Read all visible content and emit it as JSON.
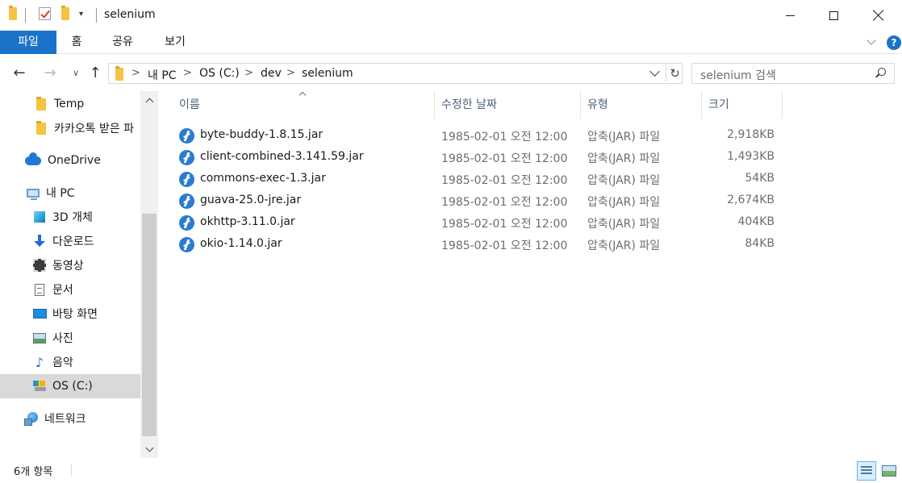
{
  "window": {
    "title": "selenium"
  },
  "ribbon": {
    "tabs": [
      {
        "label": "파일"
      },
      {
        "label": "홈"
      },
      {
        "label": "공유"
      },
      {
        "label": "보기"
      }
    ],
    "help_label": "?"
  },
  "navigation": {
    "breadcrumb": [
      "내 PC",
      "OS (C:)",
      "dev",
      "selenium"
    ],
    "separator": ">",
    "search_placeholder": "selenium 검색"
  },
  "sidebar": {
    "items": [
      {
        "label": "Temp",
        "icon": "folder-icon"
      },
      {
        "label": "카카오톡 받은 파",
        "icon": "folder-icon"
      },
      {
        "label": "OneDrive",
        "icon": "onedrive-icon"
      },
      {
        "label": "내 PC",
        "icon": "pc-icon"
      },
      {
        "label": "3D 개체",
        "icon": "3d-objects-icon"
      },
      {
        "label": "다운로드",
        "icon": "downloads-icon"
      },
      {
        "label": "동영상",
        "icon": "videos-icon"
      },
      {
        "label": "문서",
        "icon": "documents-icon"
      },
      {
        "label": "바탕 화면",
        "icon": "desktop-icon"
      },
      {
        "label": "사진",
        "icon": "pictures-icon"
      },
      {
        "label": "음악",
        "icon": "music-icon"
      },
      {
        "label": "OS (C:)",
        "icon": "drive-icon",
        "selected": true
      },
      {
        "label": "네트워크",
        "icon": "network-icon"
      }
    ]
  },
  "file_list": {
    "columns": [
      "이름",
      "수정한 날짜",
      "유형",
      "크기"
    ],
    "rows": [
      {
        "name": "byte-buddy-1.8.15.jar",
        "date": "1985-02-01 오전 12:00",
        "type": "압축(JAR) 파일",
        "size": "2,918KB"
      },
      {
        "name": "client-combined-3.141.59.jar",
        "date": "1985-02-01 오전 12:00",
        "type": "압축(JAR) 파일",
        "size": "1,493KB"
      },
      {
        "name": "commons-exec-1.3.jar",
        "date": "1985-02-01 오전 12:00",
        "type": "압축(JAR) 파일",
        "size": "54KB"
      },
      {
        "name": "guava-25.0-jre.jar",
        "date": "1985-02-01 오전 12:00",
        "type": "압축(JAR) 파일",
        "size": "2,674KB"
      },
      {
        "name": "okhttp-3.11.0.jar",
        "date": "1985-02-01 오전 12:00",
        "type": "압축(JAR) 파일",
        "size": "404KB"
      },
      {
        "name": "okio-1.14.0.jar",
        "date": "1985-02-01 오전 12:00",
        "type": "압축(JAR) 파일",
        "size": "84KB"
      }
    ]
  },
  "status": {
    "item_count": "6개 항목"
  },
  "colors": {
    "accent": "#1a73c8",
    "selection": "#d9d9d9",
    "header_text": "#4c607a"
  }
}
